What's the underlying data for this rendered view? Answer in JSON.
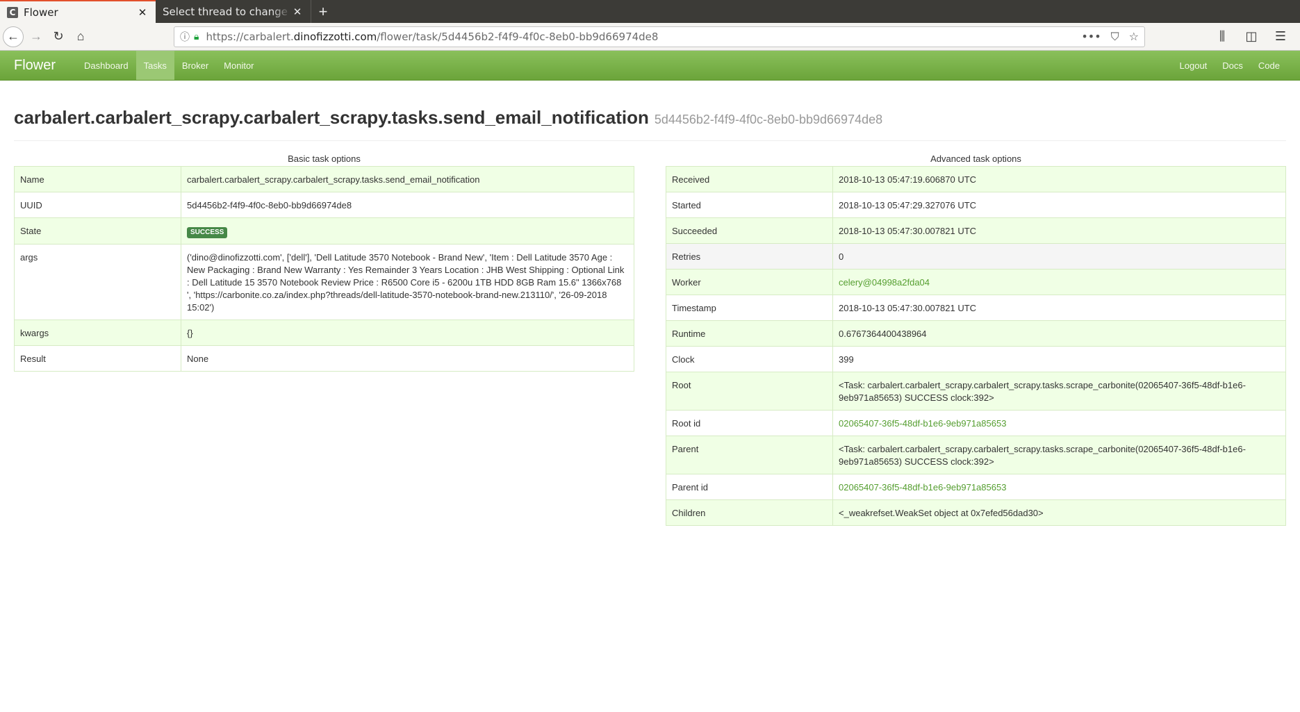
{
  "browser": {
    "tabs": [
      {
        "title": "Flower",
        "favicon": "C",
        "active": true
      },
      {
        "title": "Select thread to change | Ca",
        "active": false
      }
    ],
    "new_tab": "+",
    "url_prefix": "https://carbalert.",
    "url_domain": "dinofizzotti.com",
    "url_path": "/flower/task/5d4456b2-f4f9-4f0c-8eb0-bb9d66974de8"
  },
  "navbar": {
    "brand": "Flower",
    "items": [
      "Dashboard",
      "Tasks",
      "Broker",
      "Monitor"
    ],
    "active": "Tasks",
    "right": [
      "Logout",
      "Docs",
      "Code"
    ]
  },
  "task": {
    "name": "carbalert.carbalert_scrapy.carbalert_scrapy.tasks.send_email_notification",
    "uuid": "5d4456b2-f4f9-4f0c-8eb0-bb9d66974de8"
  },
  "basic": {
    "caption": "Basic task options",
    "rows": [
      {
        "key": "Name",
        "value": "carbalert.carbalert_scrapy.carbalert_scrapy.tasks.send_email_notification"
      },
      {
        "key": "UUID",
        "value": "5d4456b2-f4f9-4f0c-8eb0-bb9d66974de8"
      },
      {
        "key": "State",
        "value": "SUCCESS"
      },
      {
        "key": "args",
        "value": "('dino@dinofizzotti.com', ['dell'], 'Dell Latitude 3570 Notebook - Brand New', 'Item : Dell Latitude 3570 Age : New Packaging : Brand New Warranty : Yes Remainder 3 Years Location : JHB West Shipping : Optional Link : Dell Latitude 15 3570 Notebook Review Price : R6500 Core i5 - 6200u 1TB HDD 8GB Ram 15.6\" 1366x768 ', 'https://carbonite.co.za/index.php?threads/dell-latitude-3570-notebook-brand-new.213110/', '26-09-2018 15:02')"
      },
      {
        "key": "kwargs",
        "value": "{}"
      },
      {
        "key": "Result",
        "value": "None"
      }
    ]
  },
  "advanced": {
    "caption": "Advanced task options",
    "rows": [
      {
        "key": "Received",
        "value": "2018-10-13 05:47:19.606870 UTC"
      },
      {
        "key": "Started",
        "value": "2018-10-13 05:47:29.327076 UTC"
      },
      {
        "key": "Succeeded",
        "value": "2018-10-13 05:47:30.007821 UTC"
      },
      {
        "key": "Retries",
        "value": "0"
      },
      {
        "key": "Worker",
        "value": "celery@04998a2fda04"
      },
      {
        "key": "Timestamp",
        "value": "2018-10-13 05:47:30.007821 UTC"
      },
      {
        "key": "Runtime",
        "value": "0.6767364400438964"
      },
      {
        "key": "Clock",
        "value": "399"
      },
      {
        "key": "Root",
        "value": "<Task: carbalert.carbalert_scrapy.carbalert_scrapy.tasks.scrape_carbonite(02065407-36f5-48df-b1e6-9eb971a85653) SUCCESS clock:392>"
      },
      {
        "key": "Root id",
        "value": "02065407-36f5-48df-b1e6-9eb971a85653"
      },
      {
        "key": "Parent",
        "value": "<Task: carbalert.carbalert_scrapy.carbalert_scrapy.tasks.scrape_carbonite(02065407-36f5-48df-b1e6-9eb971a85653) SUCCESS clock:392>"
      },
      {
        "key": "Parent id",
        "value": "02065407-36f5-48df-b1e6-9eb971a85653"
      },
      {
        "key": "Children",
        "value": "<_weakrefset.WeakSet object at 0x7efed56dad30>"
      }
    ]
  }
}
